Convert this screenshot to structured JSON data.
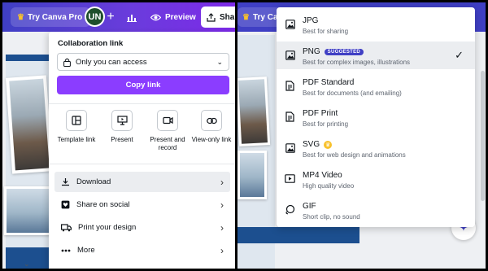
{
  "header": {
    "try_pro_label": "Try Canva Pro",
    "avatar_initials": "UN",
    "plus_label": "+",
    "preview_label": "Preview",
    "share_label": "Sha"
  },
  "share_panel": {
    "collab_label": "Collaboration link",
    "access_value": "Only you can access",
    "copy_link_label": "Copy link",
    "options": [
      {
        "label": "Template link",
        "icon": "template-icon"
      },
      {
        "label": "Present",
        "icon": "present-icon"
      },
      {
        "label": "Present and record",
        "icon": "record-icon"
      },
      {
        "label": "View-only link",
        "icon": "link-icon"
      }
    ],
    "rows": [
      {
        "label": "Download",
        "icon": "download-icon"
      },
      {
        "label": "Share on social",
        "icon": "heart-icon"
      },
      {
        "label": "Print your design",
        "icon": "truck-icon"
      },
      {
        "label": "More",
        "icon": "more-icon"
      }
    ]
  },
  "right_header": {
    "try_pro_label": "Try Canva"
  },
  "download_menu": {
    "formats": [
      {
        "name": "JPG",
        "desc": "Best for sharing",
        "icon": "image-icon"
      },
      {
        "name": "PNG",
        "desc": "Best for complex images, illustrations",
        "icon": "image-icon",
        "badge": "SUGGESTED"
      },
      {
        "name": "PDF Standard",
        "desc": "Best for documents (and emailing)",
        "icon": "document-icon"
      },
      {
        "name": "PDF Print",
        "desc": "Best for printing",
        "icon": "document-icon"
      },
      {
        "name": "SVG",
        "desc": "Best for web design and animations",
        "icon": "image-icon"
      },
      {
        "name": "MP4 Video",
        "desc": "High quality video",
        "icon": "video-icon"
      },
      {
        "name": "GIF",
        "desc": "Short clip, no sound",
        "icon": "gif-icon"
      }
    ]
  },
  "colors": {
    "header_gradient_start": "#3f3fc4",
    "header_gradient_end": "#7d2ae8",
    "primary_button": "#8b3dff",
    "badge": "#3f3fc4",
    "crown": "#f8c12b"
  }
}
